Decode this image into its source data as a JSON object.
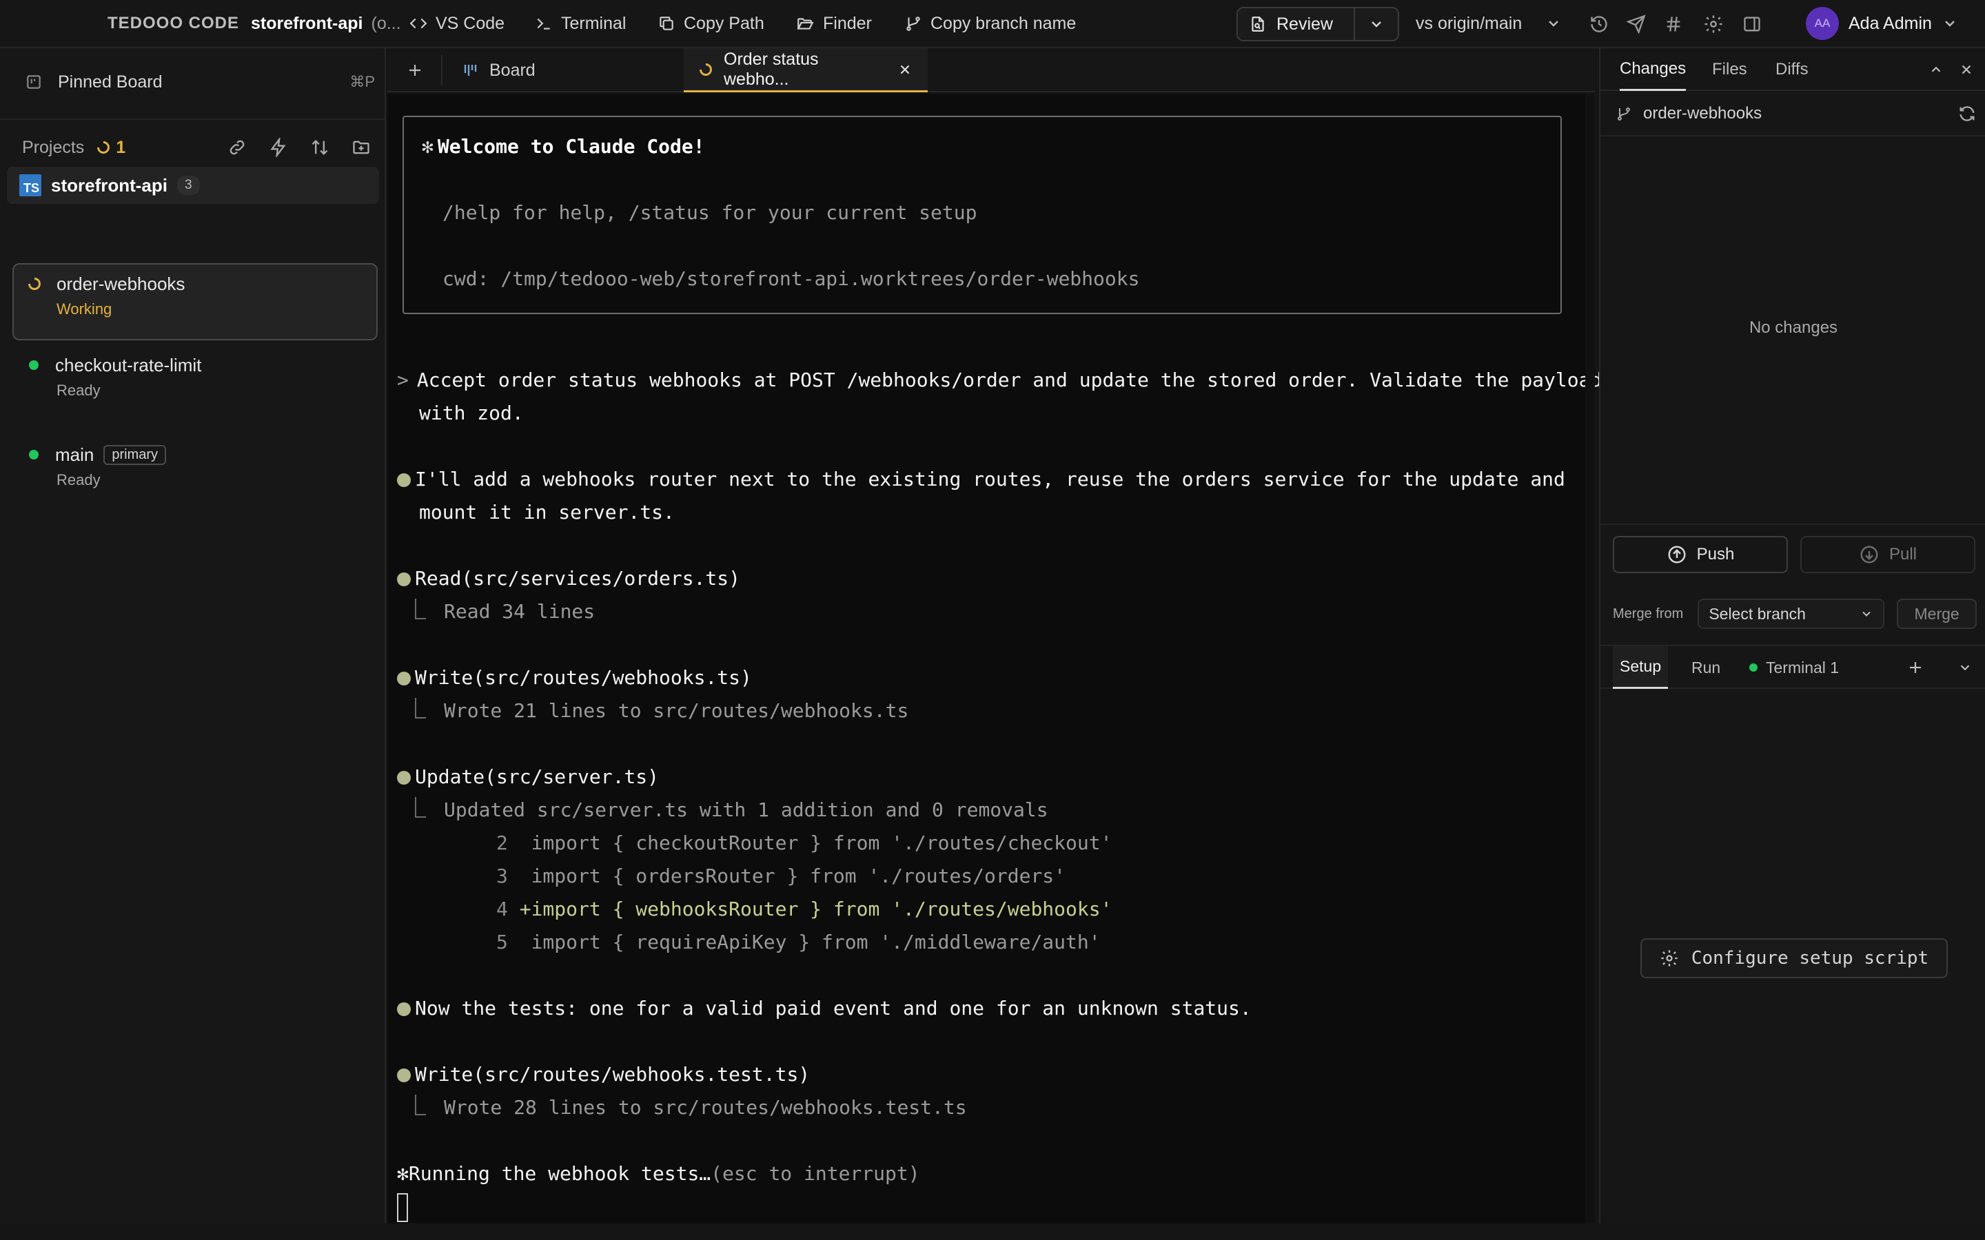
{
  "topbar": {
    "brand": "TEDOOO CODE",
    "project_title": "storefront-api",
    "project_title_suffix": " (o...",
    "vscode_label": "VS Code",
    "terminal_label": "Terminal",
    "copy_path_label": "Copy Path",
    "finder_label": "Finder",
    "copy_branch_label": "Copy branch name",
    "review_label": "Review",
    "compare_label": "vs origin/main",
    "user_initials": "AA",
    "user_name": "Ada Admin"
  },
  "sidebar": {
    "pinned_label": "Pinned Board",
    "pinned_shortcut": "⌘P",
    "projects_label": "Projects",
    "projects_running": "1",
    "project": {
      "badge": "TS",
      "name": "storefront-api",
      "count": "3"
    },
    "worktrees": [
      {
        "name": "order-webhooks",
        "status": "Working"
      },
      {
        "name": "checkout-rate-limit",
        "status": "Ready"
      },
      {
        "name": "main",
        "tag": "primary",
        "status": "Ready"
      }
    ]
  },
  "tabs": {
    "board_label": "Board",
    "active_label": "Order status webho..."
  },
  "terminal": {
    "welcome_title": "Welcome to Claude Code!",
    "welcome_help": "/help for help, /status for your current setup",
    "welcome_cwd": "cwd: /tmp/tedooo-web/storefront-api.worktrees/order-webhooks",
    "prompt_line1": "Accept order status webhooks at POST /webhooks/order and update the stored order. Validate the payload",
    "prompt_line2": "with zod.",
    "msg1_line1": "I'll add a webhooks router next to the existing routes, reuse the orders service for the update and",
    "msg1_line2": "mount it in server.ts.",
    "tool1": "Read(src/services/orders.ts)",
    "tool1_result": "Read 34 lines",
    "tool2": "Write(src/routes/webhooks.ts)",
    "tool2_result": "Wrote 21 lines to src/routes/webhooks.ts",
    "tool3": "Update(src/server.ts)",
    "tool3_result": "Updated src/server.ts with 1 addition and 0 removals",
    "diff": [
      {
        "num": "2",
        "text": "  import { checkoutRouter } from './routes/checkout'",
        "added": false
      },
      {
        "num": "3",
        "text": "  import { ordersRouter } from './routes/orders'",
        "added": false
      },
      {
        "num": "4",
        "text": " +import { webhooksRouter } from './routes/webhooks'",
        "added": true
      },
      {
        "num": "5",
        "text": "  import { requireApiKey } from './middleware/auth'",
        "added": false
      }
    ],
    "msg2": "Now the tests: one for a valid paid event and one for an unknown status.",
    "tool4": "Write(src/routes/webhooks.test.ts)",
    "tool4_result": "Wrote 28 lines to src/routes/webhooks.test.ts",
    "running": "Running the webhook tests…",
    "running_hint": "(esc to interrupt)"
  },
  "right_panel": {
    "tab_changes": "Changes",
    "tab_files": "Files",
    "tab_diffs": "Diffs",
    "branch": "order-webhooks",
    "empty_text": "No changes",
    "push_label": "Push",
    "pull_label": "Pull",
    "merge_from_label": "Merge from",
    "merge_select_placeholder": "Select branch",
    "merge_label": "Merge",
    "sub_setup": "Setup",
    "sub_run": "Run",
    "sub_terminal": "Terminal 1",
    "configure_label": "Configure setup script"
  },
  "colors": {
    "accent_working": "#e3b341",
    "ready_dot": "#22c55e",
    "ts_badge": "#3178c6",
    "avatar": "#5b30b8",
    "diff_added": "#c7d18f",
    "bullet": "#b4b88e"
  }
}
